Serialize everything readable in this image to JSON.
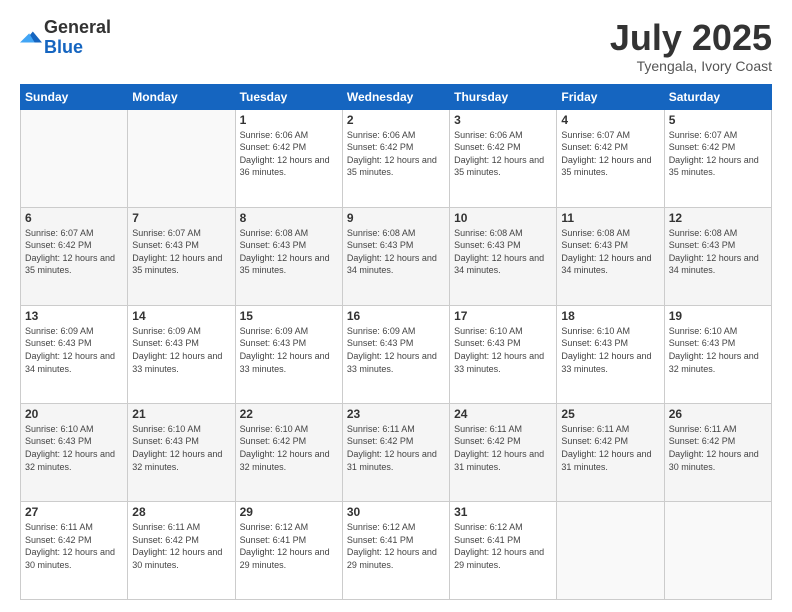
{
  "header": {
    "logo_general": "General",
    "logo_blue": "Blue",
    "month": "July 2025",
    "location": "Tyengala, Ivory Coast"
  },
  "days_of_week": [
    "Sunday",
    "Monday",
    "Tuesday",
    "Wednesday",
    "Thursday",
    "Friday",
    "Saturday"
  ],
  "weeks": [
    [
      {
        "day": "",
        "info": ""
      },
      {
        "day": "",
        "info": ""
      },
      {
        "day": "1",
        "info": "Sunrise: 6:06 AM\nSunset: 6:42 PM\nDaylight: 12 hours and 36 minutes."
      },
      {
        "day": "2",
        "info": "Sunrise: 6:06 AM\nSunset: 6:42 PM\nDaylight: 12 hours and 35 minutes."
      },
      {
        "day": "3",
        "info": "Sunrise: 6:06 AM\nSunset: 6:42 PM\nDaylight: 12 hours and 35 minutes."
      },
      {
        "day": "4",
        "info": "Sunrise: 6:07 AM\nSunset: 6:42 PM\nDaylight: 12 hours and 35 minutes."
      },
      {
        "day": "5",
        "info": "Sunrise: 6:07 AM\nSunset: 6:42 PM\nDaylight: 12 hours and 35 minutes."
      }
    ],
    [
      {
        "day": "6",
        "info": "Sunrise: 6:07 AM\nSunset: 6:42 PM\nDaylight: 12 hours and 35 minutes."
      },
      {
        "day": "7",
        "info": "Sunrise: 6:07 AM\nSunset: 6:43 PM\nDaylight: 12 hours and 35 minutes."
      },
      {
        "day": "8",
        "info": "Sunrise: 6:08 AM\nSunset: 6:43 PM\nDaylight: 12 hours and 35 minutes."
      },
      {
        "day": "9",
        "info": "Sunrise: 6:08 AM\nSunset: 6:43 PM\nDaylight: 12 hours and 34 minutes."
      },
      {
        "day": "10",
        "info": "Sunrise: 6:08 AM\nSunset: 6:43 PM\nDaylight: 12 hours and 34 minutes."
      },
      {
        "day": "11",
        "info": "Sunrise: 6:08 AM\nSunset: 6:43 PM\nDaylight: 12 hours and 34 minutes."
      },
      {
        "day": "12",
        "info": "Sunrise: 6:08 AM\nSunset: 6:43 PM\nDaylight: 12 hours and 34 minutes."
      }
    ],
    [
      {
        "day": "13",
        "info": "Sunrise: 6:09 AM\nSunset: 6:43 PM\nDaylight: 12 hours and 34 minutes."
      },
      {
        "day": "14",
        "info": "Sunrise: 6:09 AM\nSunset: 6:43 PM\nDaylight: 12 hours and 33 minutes."
      },
      {
        "day": "15",
        "info": "Sunrise: 6:09 AM\nSunset: 6:43 PM\nDaylight: 12 hours and 33 minutes."
      },
      {
        "day": "16",
        "info": "Sunrise: 6:09 AM\nSunset: 6:43 PM\nDaylight: 12 hours and 33 minutes."
      },
      {
        "day": "17",
        "info": "Sunrise: 6:10 AM\nSunset: 6:43 PM\nDaylight: 12 hours and 33 minutes."
      },
      {
        "day": "18",
        "info": "Sunrise: 6:10 AM\nSunset: 6:43 PM\nDaylight: 12 hours and 33 minutes."
      },
      {
        "day": "19",
        "info": "Sunrise: 6:10 AM\nSunset: 6:43 PM\nDaylight: 12 hours and 32 minutes."
      }
    ],
    [
      {
        "day": "20",
        "info": "Sunrise: 6:10 AM\nSunset: 6:43 PM\nDaylight: 12 hours and 32 minutes."
      },
      {
        "day": "21",
        "info": "Sunrise: 6:10 AM\nSunset: 6:43 PM\nDaylight: 12 hours and 32 minutes."
      },
      {
        "day": "22",
        "info": "Sunrise: 6:10 AM\nSunset: 6:42 PM\nDaylight: 12 hours and 32 minutes."
      },
      {
        "day": "23",
        "info": "Sunrise: 6:11 AM\nSunset: 6:42 PM\nDaylight: 12 hours and 31 minutes."
      },
      {
        "day": "24",
        "info": "Sunrise: 6:11 AM\nSunset: 6:42 PM\nDaylight: 12 hours and 31 minutes."
      },
      {
        "day": "25",
        "info": "Sunrise: 6:11 AM\nSunset: 6:42 PM\nDaylight: 12 hours and 31 minutes."
      },
      {
        "day": "26",
        "info": "Sunrise: 6:11 AM\nSunset: 6:42 PM\nDaylight: 12 hours and 30 minutes."
      }
    ],
    [
      {
        "day": "27",
        "info": "Sunrise: 6:11 AM\nSunset: 6:42 PM\nDaylight: 12 hours and 30 minutes."
      },
      {
        "day": "28",
        "info": "Sunrise: 6:11 AM\nSunset: 6:42 PM\nDaylight: 12 hours and 30 minutes."
      },
      {
        "day": "29",
        "info": "Sunrise: 6:12 AM\nSunset: 6:41 PM\nDaylight: 12 hours and 29 minutes."
      },
      {
        "day": "30",
        "info": "Sunrise: 6:12 AM\nSunset: 6:41 PM\nDaylight: 12 hours and 29 minutes."
      },
      {
        "day": "31",
        "info": "Sunrise: 6:12 AM\nSunset: 6:41 PM\nDaylight: 12 hours and 29 minutes."
      },
      {
        "day": "",
        "info": ""
      },
      {
        "day": "",
        "info": ""
      }
    ]
  ]
}
